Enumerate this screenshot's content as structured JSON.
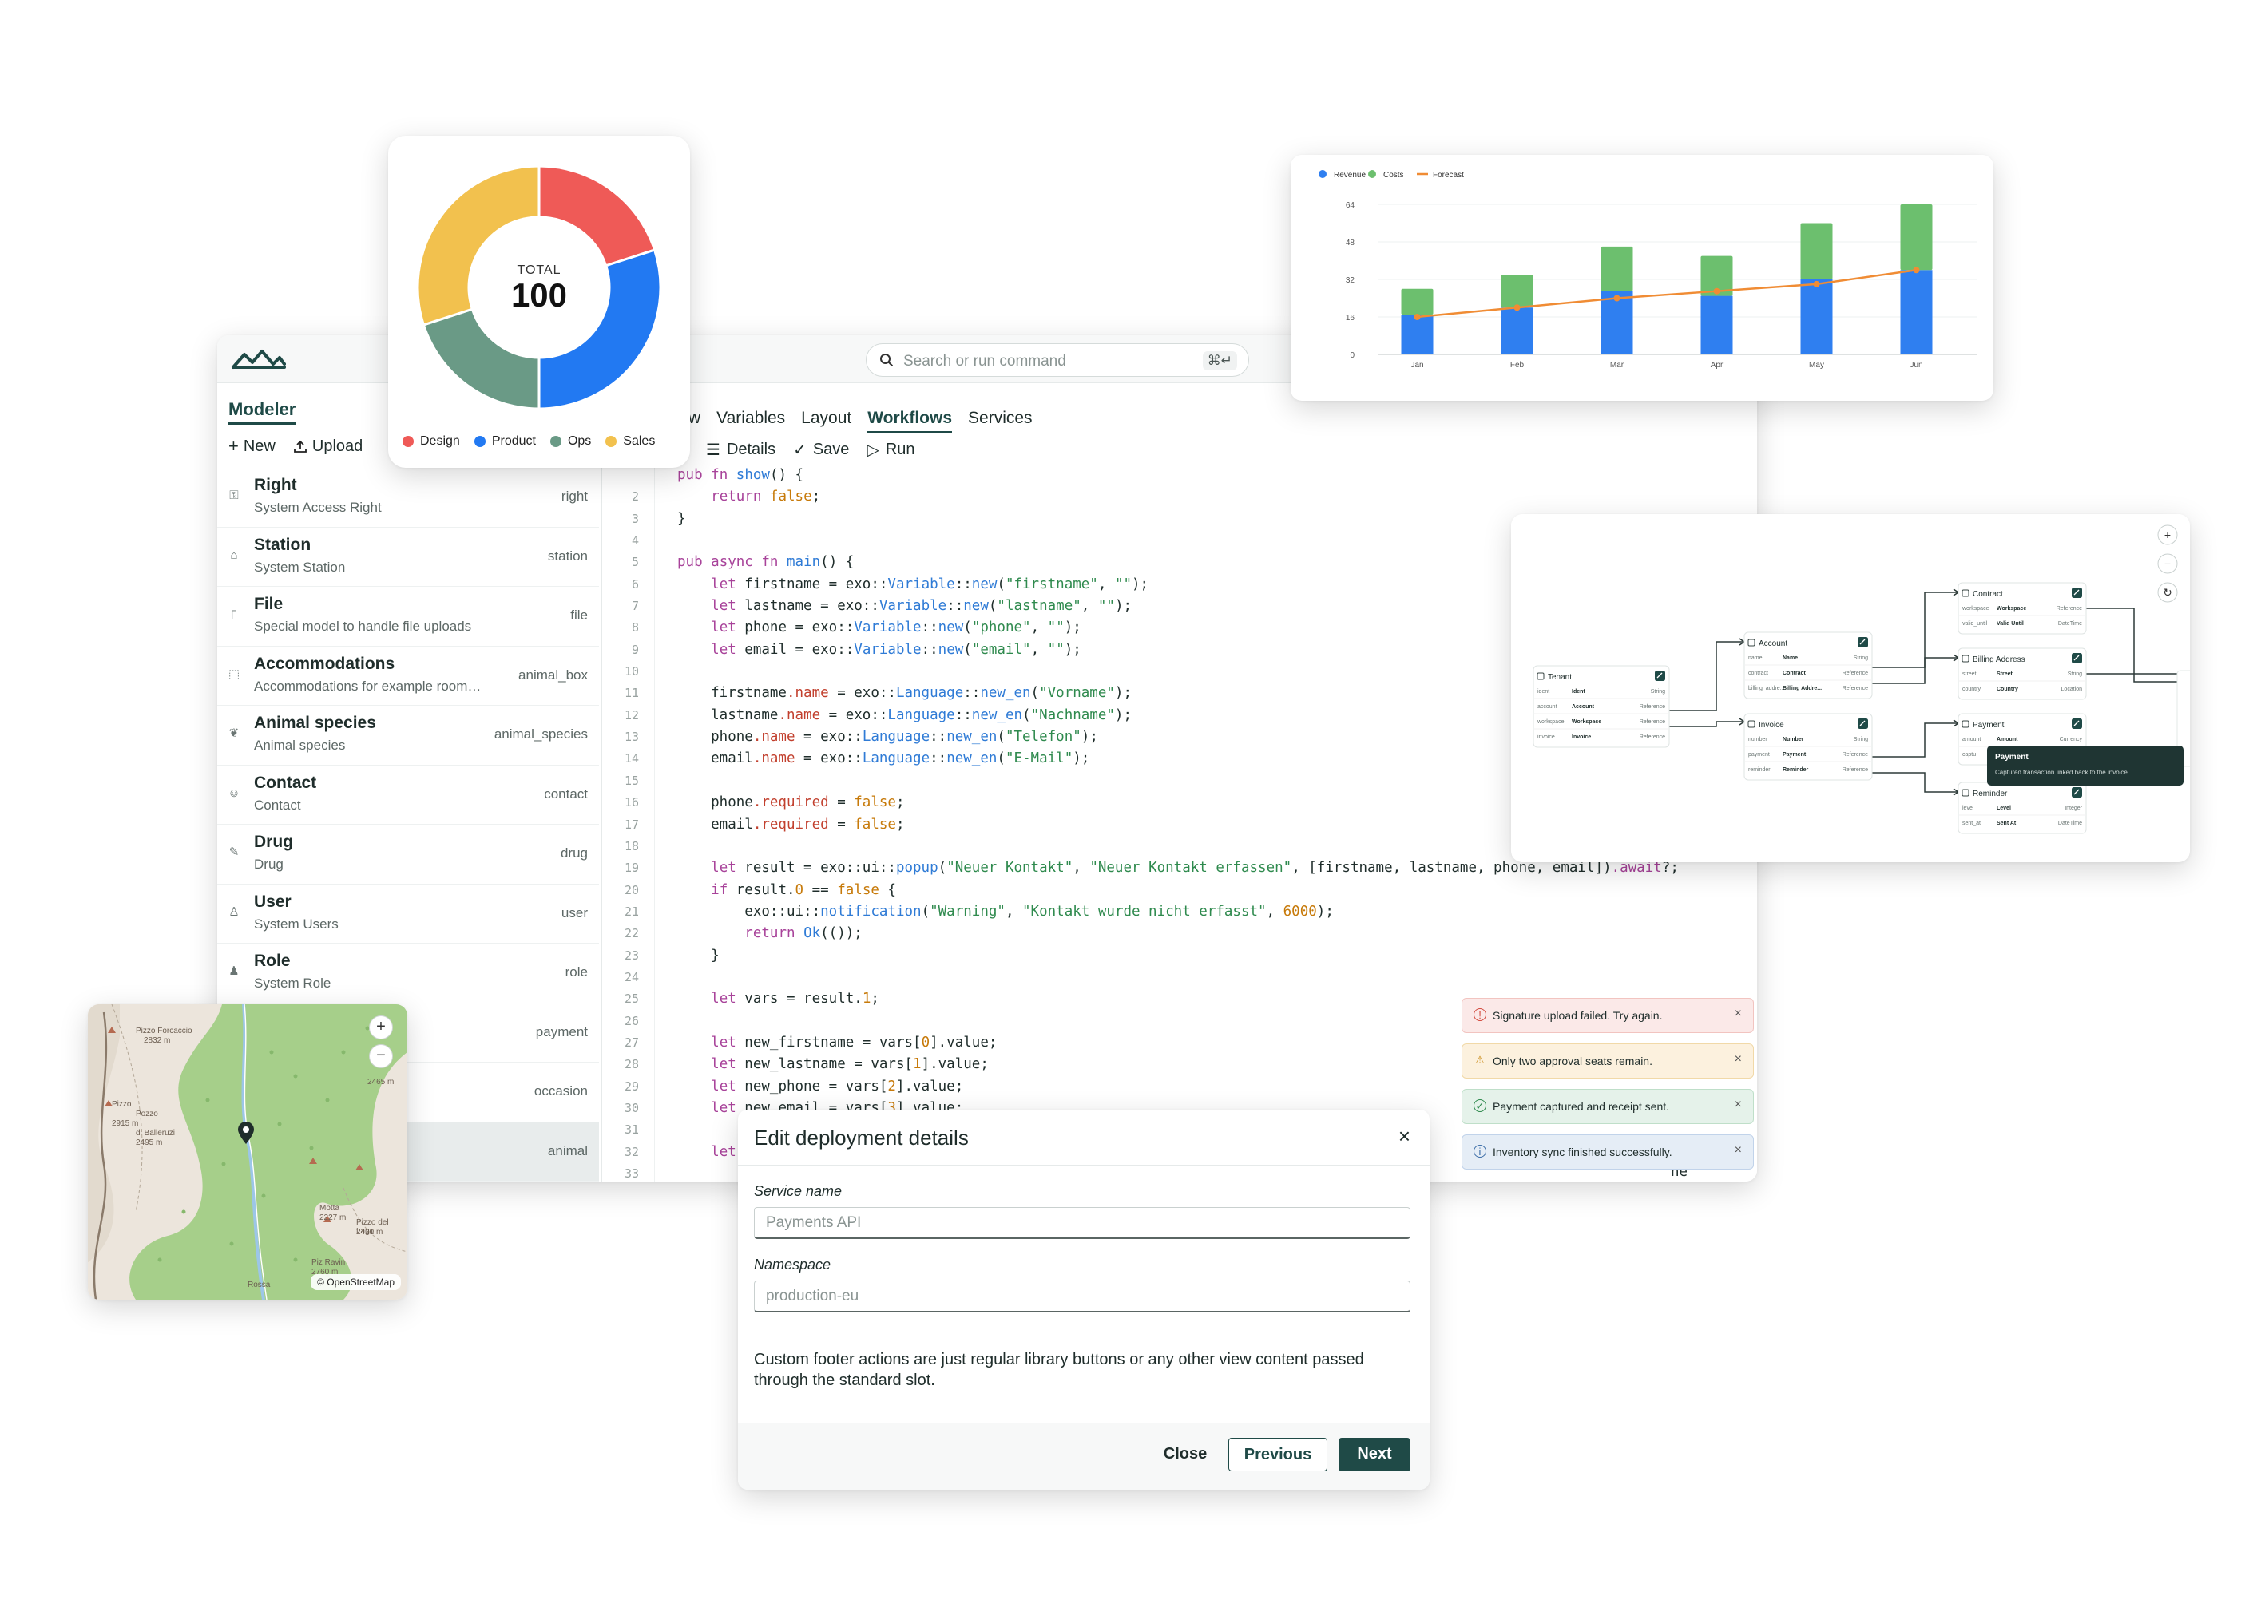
{
  "app": {
    "search_placeholder": "Search or run command",
    "search_shortcut": "⌘↵",
    "sidebar_title": "Modeler",
    "new_label": "New",
    "upload_label": "Upload",
    "models": [
      {
        "name": "Right",
        "desc": "System Access Right",
        "id": "right",
        "icon": "key-icon"
      },
      {
        "name": "Station",
        "desc": "System Station",
        "id": "station",
        "icon": "bank-icon"
      },
      {
        "name": "File",
        "desc": "Special model to handle file uploads",
        "id": "file",
        "icon": "file-icon"
      },
      {
        "name": "Accommodations",
        "desc": "Accommodations for example room…",
        "id": "animal_box",
        "icon": "box-icon"
      },
      {
        "name": "Animal species",
        "desc": "Animal species",
        "id": "animal_species",
        "icon": "leaf-icon"
      },
      {
        "name": "Contact",
        "desc": "Contact",
        "id": "contact",
        "icon": "contact-icon"
      },
      {
        "name": "Drug",
        "desc": "Drug",
        "id": "drug",
        "icon": "pill-icon"
      },
      {
        "name": "User",
        "desc": "System Users",
        "id": "user",
        "icon": "user-icon"
      },
      {
        "name": "Role",
        "desc": "System Role",
        "id": "role",
        "icon": "role-icon"
      },
      {
        "name": "",
        "desc": "",
        "id": "payment",
        "icon": ""
      },
      {
        "name": "",
        "desc": "",
        "id": "occasion",
        "icon": ""
      },
      {
        "name": "",
        "desc": "",
        "id": "animal",
        "icon": ""
      }
    ],
    "tabs": [
      "w",
      "Variables",
      "Layout",
      "Workflows",
      "Services"
    ],
    "active_tab": "Workflows",
    "toolbar": {
      "details": "Details",
      "save": "Save",
      "run": "Run"
    },
    "code_lines": [
      {
        "n": "",
        "t": "pub fn show() {"
      },
      {
        "n": "2",
        "t": "    return false;"
      },
      {
        "n": "3",
        "t": "}"
      },
      {
        "n": "4",
        "t": ""
      },
      {
        "n": "5",
        "t": "pub async fn main() {"
      },
      {
        "n": "6",
        "t": "    let firstname = exo::Variable::new(\"firstname\", \"\");"
      },
      {
        "n": "7",
        "t": "    let lastname = exo::Variable::new(\"lastname\", \"\");"
      },
      {
        "n": "8",
        "t": "    let phone = exo::Variable::new(\"phone\", \"\");"
      },
      {
        "n": "9",
        "t": "    let email = exo::Variable::new(\"email\", \"\");"
      },
      {
        "n": "10",
        "t": ""
      },
      {
        "n": "11",
        "t": "    firstname.name = exo::Language::new_en(\"Vorname\");"
      },
      {
        "n": "12",
        "t": "    lastname.name = exo::Language::new_en(\"Nachname\");"
      },
      {
        "n": "13",
        "t": "    phone.name = exo::Language::new_en(\"Telefon\");"
      },
      {
        "n": "14",
        "t": "    email.name = exo::Language::new_en(\"E-Mail\");"
      },
      {
        "n": "15",
        "t": ""
      },
      {
        "n": "16",
        "t": "    phone.required = false;"
      },
      {
        "n": "17",
        "t": "    email.required = false;"
      },
      {
        "n": "18",
        "t": ""
      },
      {
        "n": "19",
        "t": "    let result = exo::ui::popup(\"Neuer Kontakt\", \"Neuer Kontakt erfassen\", [firstname, lastname, phone, email]).await?;"
      },
      {
        "n": "20",
        "t": "    if result.0 == false {"
      },
      {
        "n": "21",
        "t": "        exo::ui::notification(\"Warning\", \"Kontakt wurde nicht erfasst\", 6000);"
      },
      {
        "n": "22",
        "t": "        return Ok(());"
      },
      {
        "n": "23",
        "t": "    }"
      },
      {
        "n": "24",
        "t": ""
      },
      {
        "n": "25",
        "t": "    let vars = result.1;"
      },
      {
        "n": "26",
        "t": ""
      },
      {
        "n": "27",
        "t": "    let new_firstname = vars[0].value;"
      },
      {
        "n": "28",
        "t": "    let new_lastname = vars[1].value;"
      },
      {
        "n": "29",
        "t": "    let new_phone = vars[2].value;"
      },
      {
        "n": "30",
        "t": "    let new_email = vars[3].value;"
      },
      {
        "n": "31",
        "t": ""
      },
      {
        "n": "32",
        "t": "    let"
      },
      {
        "n": "33",
        "t": ""
      }
    ],
    "code_overflow_fragment": "ne"
  },
  "donut": {
    "center_label": "TOTAL",
    "center_value": "100",
    "colors": {
      "Design": "#ef5a57",
      "Product": "#2279f2",
      "Ops": "#6a9a86",
      "Sales": "#f2c14e"
    }
  },
  "bar_chart": {
    "colors": {
      "Revenue": "#2f7ff0",
      "Costs": "#6cbf6e",
      "Forecast": "#f08c34"
    }
  },
  "chart_data": [
    {
      "type": "pie",
      "categories": [
        "Design",
        "Product",
        "Ops",
        "Sales"
      ],
      "values": [
        20,
        30,
        20,
        30
      ],
      "title": "",
      "center_text": "TOTAL 100"
    },
    {
      "type": "bar",
      "stacked": true,
      "categories": [
        "Jan",
        "Feb",
        "Mar",
        "Apr",
        "May",
        "Jun"
      ],
      "series": [
        {
          "name": "Revenue",
          "values": [
            17,
            20,
            27,
            25,
            32,
            36
          ]
        },
        {
          "name": "Costs",
          "values": [
            11,
            14,
            19,
            17,
            24,
            28
          ]
        },
        {
          "name": "Forecast",
          "values": [
            16,
            20,
            24,
            27,
            30,
            36
          ],
          "type": "line"
        }
      ],
      "yticks": [
        0,
        16,
        32,
        48,
        64
      ],
      "ylim": [
        0,
        64
      ],
      "grid": true,
      "legend": "top-left",
      "xlabel": "",
      "ylabel": ""
    }
  ],
  "diagram": {
    "nodes": [
      {
        "title": "Tenant",
        "fields": [
          [
            "ident",
            "Ident",
            "String"
          ],
          [
            "account",
            "Account",
            "Reference"
          ],
          [
            "workspace",
            "Workspace",
            "Reference"
          ],
          [
            "invoice",
            "Invoice",
            "Reference"
          ]
        ]
      },
      {
        "title": "Account",
        "fields": [
          [
            "name",
            "Name",
            "String"
          ],
          [
            "contract",
            "Contract",
            "Reference"
          ],
          [
            "billing_addre...",
            "Billing Addre...",
            "Reference"
          ]
        ]
      },
      {
        "title": "Invoice",
        "fields": [
          [
            "number",
            "Number",
            "String"
          ],
          [
            "payment",
            "Payment",
            "Reference"
          ],
          [
            "reminder",
            "Reminder",
            "Reference"
          ]
        ]
      },
      {
        "title": "Contract",
        "fields": [
          [
            "workspace",
            "Workspace",
            "Reference"
          ],
          [
            "valid_until",
            "Valid Until",
            "DateTime"
          ]
        ]
      },
      {
        "title": "Billing Address",
        "fields": [
          [
            "street",
            "Street",
            "String"
          ],
          [
            "country",
            "Country",
            "Location"
          ]
        ]
      },
      {
        "title": "Payment",
        "fields": [
          [
            "amount",
            "Amount",
            "Currency"
          ],
          [
            "captu",
            "",
            ""
          ]
        ]
      },
      {
        "title": "Reminder",
        "fields": [
          [
            "level",
            "Level",
            "Integer"
          ],
          [
            "sent_at",
            "Sent At",
            "DateTime"
          ]
        ]
      }
    ],
    "tooltip_title": "Payment",
    "tooltip_text": "Captured transaction linked back to the invoice."
  },
  "map": {
    "attribution": "© OpenStreetMap",
    "labels": [
      "Pizzo Forcaccio",
      "2832 m",
      "2465 m",
      "Pizzo",
      "Pozzo",
      "2915 m",
      "Motta",
      "2227 m",
      "Pizzo del Lago",
      "2421 m",
      "Piz Ravin",
      "2760 m",
      "Rossa",
      "di Balleruzi",
      "2495 m"
    ]
  },
  "toasts": [
    {
      "kind": "error",
      "text": "Signature upload failed. Try again."
    },
    {
      "kind": "warning",
      "text": "Only two approval seats remain."
    },
    {
      "kind": "success",
      "text": "Payment captured and receipt sent."
    },
    {
      "kind": "info",
      "text": "Inventory sync finished successfully."
    }
  ],
  "modal": {
    "title": "Edit deployment details",
    "service_label": "Service name",
    "service_placeholder": "Payments API",
    "namespace_label": "Namespace",
    "namespace_placeholder": "production-eu",
    "description": "Custom footer actions are just regular library buttons or any other view content passed through the standard slot.",
    "close_label": "Close",
    "previous_label": "Previous",
    "next_label": "Next"
  }
}
